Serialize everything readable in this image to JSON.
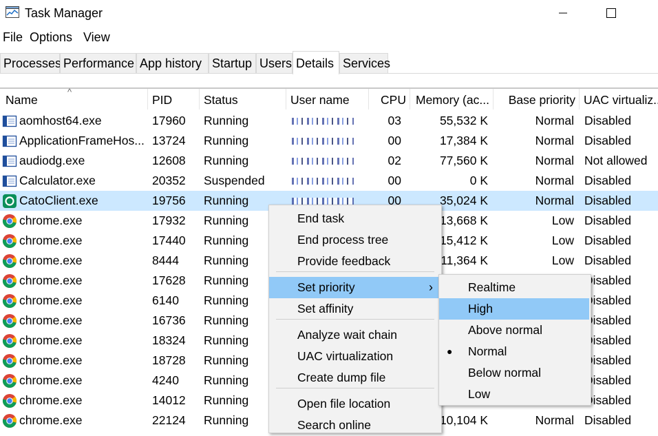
{
  "window": {
    "title": "Task Manager",
    "minimize_icon": "minimize-icon",
    "maximize_icon": "maximize-icon"
  },
  "menu": [
    "File",
    "Options",
    "View"
  ],
  "tabs": [
    "Processes",
    "Performance",
    "App history",
    "Startup",
    "Users",
    "Details",
    "Services"
  ],
  "active_tab": "Details",
  "columns": [
    "Name",
    "PID",
    "Status",
    "User name",
    "CPU",
    "Memory (ac...",
    "Base priority",
    "UAC virtualiz..."
  ],
  "rows": [
    {
      "name": "aomhost64.exe",
      "pid": "17960",
      "status": "Running",
      "cpu": "03",
      "mem": "55,532 K",
      "prio": "Normal",
      "uac": "Disabled",
      "icon": "app-window-icon"
    },
    {
      "name": "ApplicationFrameHos...",
      "pid": "13724",
      "status": "Running",
      "cpu": "00",
      "mem": "17,384 K",
      "prio": "Normal",
      "uac": "Disabled",
      "icon": "app-window-icon"
    },
    {
      "name": "audiodg.exe",
      "pid": "12608",
      "status": "Running",
      "cpu": "02",
      "mem": "77,560 K",
      "prio": "Normal",
      "uac": "Not allowed",
      "icon": "app-window-icon"
    },
    {
      "name": "Calculator.exe",
      "pid": "20352",
      "status": "Suspended",
      "cpu": "00",
      "mem": "0 K",
      "prio": "Normal",
      "uac": "Disabled",
      "icon": "app-window-icon"
    },
    {
      "name": "CatoClient.exe",
      "pid": "19756",
      "status": "Running",
      "cpu": "00",
      "mem": "35,024 K",
      "prio": "Normal",
      "uac": "Disabled",
      "icon": "cato-icon"
    },
    {
      "name": "chrome.exe",
      "pid": "17932",
      "status": "Running",
      "cpu": "",
      "mem": "13,668 K",
      "prio": "Low",
      "uac": "Disabled",
      "icon": "chrome-icon"
    },
    {
      "name": "chrome.exe",
      "pid": "17440",
      "status": "Running",
      "cpu": "",
      "mem": "15,412 K",
      "prio": "Low",
      "uac": "Disabled",
      "icon": "chrome-icon"
    },
    {
      "name": "chrome.exe",
      "pid": "8444",
      "status": "Running",
      "cpu": "",
      "mem": "11,364 K",
      "prio": "Low",
      "uac": "Disabled",
      "icon": "chrome-icon"
    },
    {
      "name": "chrome.exe",
      "pid": "17628",
      "status": "Running",
      "cpu": "",
      "mem": "",
      "prio": "",
      "uac": "Disabled",
      "icon": "chrome-icon"
    },
    {
      "name": "chrome.exe",
      "pid": "6140",
      "status": "Running",
      "cpu": "",
      "mem": "",
      "prio": "",
      "uac": "Disabled",
      "icon": "chrome-icon"
    },
    {
      "name": "chrome.exe",
      "pid": "16736",
      "status": "Running",
      "cpu": "",
      "mem": "",
      "prio": "",
      "uac": "Disabled",
      "icon": "chrome-icon"
    },
    {
      "name": "chrome.exe",
      "pid": "18324",
      "status": "Running",
      "cpu": "",
      "mem": "",
      "prio": "",
      "uac": "Disabled",
      "icon": "chrome-icon"
    },
    {
      "name": "chrome.exe",
      "pid": "18728",
      "status": "Running",
      "cpu": "",
      "mem": "",
      "prio": "",
      "uac": "Disabled",
      "icon": "chrome-icon"
    },
    {
      "name": "chrome.exe",
      "pid": "4240",
      "status": "Running",
      "cpu": "",
      "mem": "",
      "prio": "",
      "uac": "Disabled",
      "icon": "chrome-icon"
    },
    {
      "name": "chrome.exe",
      "pid": "14012",
      "status": "Running",
      "cpu": "",
      "mem": "",
      "prio": "",
      "uac": "Disabled",
      "icon": "chrome-icon"
    },
    {
      "name": "chrome.exe",
      "pid": "22124",
      "status": "Running",
      "cpu": "",
      "mem": "10,104 K",
      "prio": "Normal",
      "uac": "Disabled",
      "icon": "chrome-icon"
    }
  ],
  "selected_row": "CatoClient.exe",
  "context_menu": {
    "items": [
      "End task",
      "End process tree",
      "Provide feedback",
      "Set priority",
      "Set affinity",
      "Analyze wait chain",
      "UAC virtualization",
      "Create dump file",
      "Open file location",
      "Search online"
    ],
    "highlighted": "Set priority",
    "submenu_arrow": "›"
  },
  "priority_submenu": {
    "items": [
      "Realtime",
      "High",
      "Above normal",
      "Normal",
      "Below normal",
      "Low"
    ],
    "highlighted": "High",
    "checked": "Normal",
    "check_glyph": "●"
  },
  "colors": {
    "selection": "#cce8ff",
    "menu_highlight": "#91c9f7",
    "menu_bg": "#f2f2f2"
  }
}
